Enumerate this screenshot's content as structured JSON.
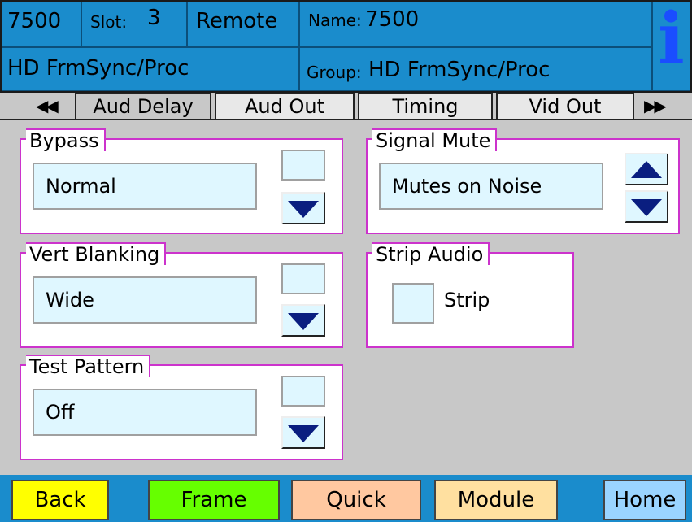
{
  "header": {
    "model": "7500",
    "slot_label": "Slot:",
    "slot_value": "3",
    "mode": "Remote",
    "name_label": "Name:",
    "name_value": "7500",
    "product": "HD FrmSync/Proc",
    "group_label": "Group:",
    "group_value": "HD FrmSync/Proc",
    "info_glyph": "i",
    "info_icon": "info-icon"
  },
  "tabs": {
    "prev_glyph": "◀◀",
    "next_glyph": "▶▶",
    "items": [
      "Aud Delay",
      "Aud Out",
      "Timing",
      "Vid Out"
    ],
    "active": "Aud Delay"
  },
  "panels": {
    "bypass": {
      "label": "Bypass",
      "value": "Normal"
    },
    "vert_blanking": {
      "label": "Vert Blanking",
      "value": "Wide"
    },
    "test_pattern": {
      "label": "Test Pattern",
      "value": "Off"
    },
    "signal_mute": {
      "label": "Signal Mute",
      "value": "Mutes on Noise"
    },
    "strip_audio": {
      "label": "Strip Audio",
      "checkbox_label": "Strip",
      "checked": false
    }
  },
  "bottom": {
    "back": "Back",
    "frame": "Frame",
    "quick": "Quick",
    "module": "Module",
    "home": "Home"
  },
  "colors": {
    "header_blue": "#1a8ccc",
    "panel_border": "#cc33cc",
    "field_bg": "#dff7ff",
    "arrow_navy": "#0a1e80",
    "back": "#ffff00",
    "frame": "#66ff00",
    "quick": "#ffc8a0",
    "module": "#ffe0a0",
    "home": "#9ad4ff"
  }
}
